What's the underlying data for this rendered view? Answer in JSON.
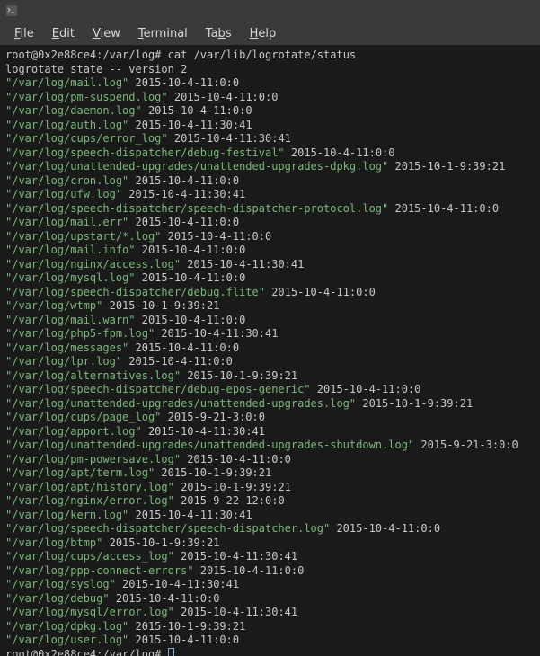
{
  "menubar": {
    "file": "File",
    "edit": "Edit",
    "view": "View",
    "terminal": "Terminal",
    "tabs": "Tabs",
    "help": "Help"
  },
  "prompt": {
    "user_host": "root@0x2e88ce4",
    "cwd": "/var/log",
    "symbol": "#"
  },
  "command": "cat /var/lib/logrotate/status",
  "state_header": "logrotate state -- version 2",
  "entries": [
    {
      "path": "/var/log/mail.log",
      "ts": "2015-10-4-11:0:0"
    },
    {
      "path": "/var/log/pm-suspend.log",
      "ts": "2015-10-4-11:0:0"
    },
    {
      "path": "/var/log/daemon.log",
      "ts": "2015-10-4-11:0:0"
    },
    {
      "path": "/var/log/auth.log",
      "ts": "2015-10-4-11:30:41"
    },
    {
      "path": "/var/log/cups/error_log",
      "ts": "2015-10-4-11:30:41"
    },
    {
      "path": "/var/log/speech-dispatcher/debug-festival",
      "ts": "2015-10-4-11:0:0"
    },
    {
      "path": "/var/log/unattended-upgrades/unattended-upgrades-dpkg.log",
      "ts": "2015-10-1-9:39:21"
    },
    {
      "path": "/var/log/cron.log",
      "ts": "2015-10-4-11:0:0"
    },
    {
      "path": "/var/log/ufw.log",
      "ts": "2015-10-4-11:30:41"
    },
    {
      "path": "/var/log/speech-dispatcher/speech-dispatcher-protocol.log",
      "ts": "2015-10-4-11:0:0"
    },
    {
      "path": "/var/log/mail.err",
      "ts": "2015-10-4-11:0:0"
    },
    {
      "path": "/var/log/upstart/*.log",
      "ts": "2015-10-4-11:0:0"
    },
    {
      "path": "/var/log/mail.info",
      "ts": "2015-10-4-11:0:0"
    },
    {
      "path": "/var/log/nginx/access.log",
      "ts": "2015-10-4-11:30:41"
    },
    {
      "path": "/var/log/mysql.log",
      "ts": "2015-10-4-11:0:0"
    },
    {
      "path": "/var/log/speech-dispatcher/debug.flite",
      "ts": "2015-10-4-11:0:0"
    },
    {
      "path": "/var/log/wtmp",
      "ts": "2015-10-1-9:39:21"
    },
    {
      "path": "/var/log/mail.warn",
      "ts": "2015-10-4-11:0:0"
    },
    {
      "path": "/var/log/php5-fpm.log",
      "ts": "2015-10-4-11:30:41"
    },
    {
      "path": "/var/log/messages",
      "ts": "2015-10-4-11:0:0"
    },
    {
      "path": "/var/log/lpr.log",
      "ts": "2015-10-4-11:0:0"
    },
    {
      "path": "/var/log/alternatives.log",
      "ts": "2015-10-1-9:39:21"
    },
    {
      "path": "/var/log/speech-dispatcher/debug-epos-generic",
      "ts": "2015-10-4-11:0:0"
    },
    {
      "path": "/var/log/unattended-upgrades/unattended-upgrades.log",
      "ts": "2015-10-1-9:39:21"
    },
    {
      "path": "/var/log/cups/page_log",
      "ts": "2015-9-21-3:0:0"
    },
    {
      "path": "/var/log/apport.log",
      "ts": "2015-10-4-11:30:41"
    },
    {
      "path": "/var/log/unattended-upgrades/unattended-upgrades-shutdown.log",
      "ts": "2015-9-21-3:0:0"
    },
    {
      "path": "/var/log/pm-powersave.log",
      "ts": "2015-10-4-11:0:0"
    },
    {
      "path": "/var/log/apt/term.log",
      "ts": "2015-10-1-9:39:21"
    },
    {
      "path": "/var/log/apt/history.log",
      "ts": "2015-10-1-9:39:21"
    },
    {
      "path": "/var/log/nginx/error.log",
      "ts": "2015-9-22-12:0:0"
    },
    {
      "path": "/var/log/kern.log",
      "ts": "2015-10-4-11:30:41"
    },
    {
      "path": "/var/log/speech-dispatcher/speech-dispatcher.log",
      "ts": "2015-10-4-11:0:0"
    },
    {
      "path": "/var/log/btmp",
      "ts": "2015-10-1-9:39:21"
    },
    {
      "path": "/var/log/cups/access_log",
      "ts": "2015-10-4-11:30:41"
    },
    {
      "path": "/var/log/ppp-connect-errors",
      "ts": "2015-10-4-11:0:0"
    },
    {
      "path": "/var/log/syslog",
      "ts": "2015-10-4-11:30:41"
    },
    {
      "path": "/var/log/debug",
      "ts": "2015-10-4-11:0:0"
    },
    {
      "path": "/var/log/mysql/error.log",
      "ts": "2015-10-4-11:30:41"
    },
    {
      "path": "/var/log/dpkg.log",
      "ts": "2015-10-1-9:39:21"
    },
    {
      "path": "/var/log/user.log",
      "ts": "2015-10-4-11:0:0"
    }
  ]
}
